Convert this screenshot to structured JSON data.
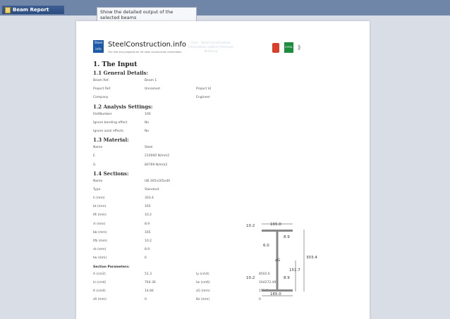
{
  "app": {
    "tab_title": "Beam Report"
  },
  "tooltip": {
    "text": "Show the detailed output of the selected beams"
  },
  "header": {
    "logo_text_line1": "Steel",
    "logo_text_line2": "info",
    "brand": "SteelConstruction.info",
    "tagline": "The free encyclopedia for UK steel construction information",
    "watermark": "Free - Steel Construction Information Lattice Premium Building",
    "org2_label": "STEEL"
  },
  "report": {
    "h_input": "1. The Input",
    "h_general": "1.1 General Details:",
    "general": [
      {
        "k1": "Beam Ref.",
        "v1": "Beam 1",
        "k2": "",
        "v2": ""
      },
      {
        "k1": "Project Ref.",
        "v1": "Unnamed",
        "k2": "Project Id",
        "v2": ""
      },
      {
        "k1": "Company",
        "v1": "",
        "k2": "Engineer",
        "v2": ""
      }
    ],
    "h_analysis": "1.2 Analysis Settings:",
    "analysis": [
      {
        "k1": "EletNumber",
        "v1": "100"
      },
      {
        "k1": "Ignore bending effect",
        "v1": "No"
      },
      {
        "k1": "Ignore axial effects",
        "v1": "No"
      }
    ],
    "h_material": "1.3 Material:",
    "material": [
      {
        "k1": "Name",
        "v1": "Steel"
      },
      {
        "k1": "E",
        "v1": "210000 N/mm2"
      },
      {
        "k1": "G",
        "v1": "80769 N/mm2"
      }
    ],
    "h_sections": "1.4 Sections:",
    "sections": [
      {
        "k1": "Name",
        "v1": "UB 305x165x40"
      },
      {
        "k1": "Type",
        "v1": "Standard"
      },
      {
        "k1": "h (mm)",
        "v1": "303.4"
      },
      {
        "k1": "bt (mm)",
        "v1": "165"
      },
      {
        "k1": "tft (mm)",
        "v1": "10.2"
      },
      {
        "k1": "rt (mm)",
        "v1": "8.9"
      },
      {
        "k1": "bb (mm)",
        "v1": "165"
      },
      {
        "k1": "tfb (mm)",
        "v1": "10.2"
      },
      {
        "k1": "rb (mm)",
        "v1": "8.9"
      },
      {
        "k1": "tw (mm)",
        "v1": "6"
      }
    ],
    "h_params": "Section Parameters:",
    "params": [
      {
        "k1": "A (cm2)",
        "v1": "51.3",
        "k2": "Iy (cm4)",
        "v2": "8502.6"
      },
      {
        "k1": "Iz (cm4)",
        "v1": "764.36",
        "k2": "Iw (cm6)",
        "v2": "164272.49"
      },
      {
        "k1": "It (cm4)",
        "v1": "14.84",
        "k2": "zG (mm)",
        "v2": "151.7"
      },
      {
        "k1": "z0 (mm)",
        "v1": "0",
        "k2": "Bz (mm)",
        "v2": "0"
      }
    ]
  },
  "diagram": {
    "flange_t_top": "10.2",
    "width_top": "165.0",
    "r_top": "8.9",
    "web_t": "6.0",
    "centroid": "zG",
    "height": "303.4",
    "zg_value": "151.7",
    "flange_t_bot": "10.2",
    "r_bot": "8.9",
    "width_bot": "165.0"
  }
}
